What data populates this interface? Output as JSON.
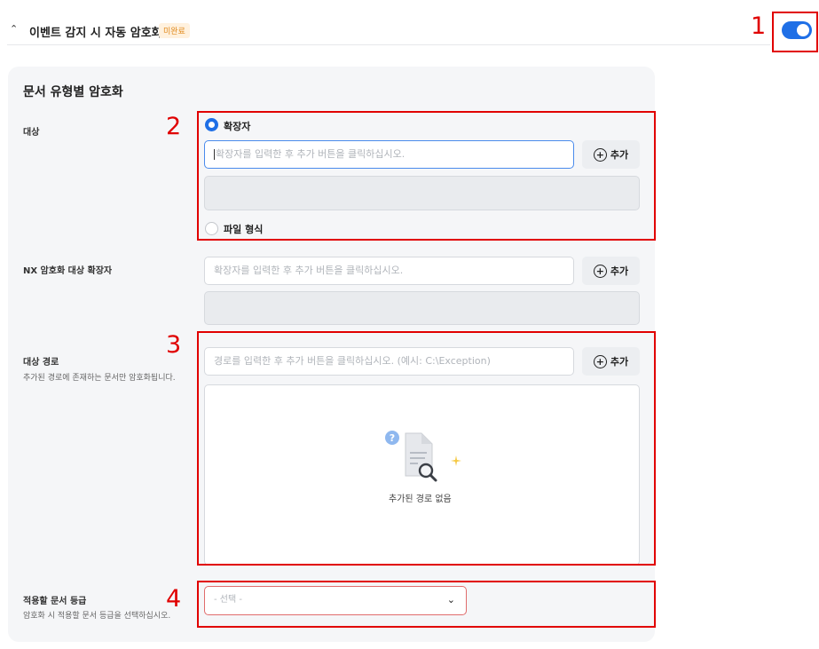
{
  "header": {
    "title": "이벤트 감지 시 자동 암호화",
    "badge": "미완료",
    "toggle_on": true
  },
  "panel": {
    "title": "문서 유형별 암호화"
  },
  "target": {
    "label": "대상",
    "options": [
      {
        "label": "확장자",
        "selected": true
      },
      {
        "label": "파일 형식",
        "selected": false
      }
    ],
    "ext_input_placeholder": "확장자를 입력한 후 추가 버튼을 클릭하십시오.",
    "add_label": "추가"
  },
  "nx": {
    "label": "NX 암호화 대상 확장자",
    "input_placeholder": "확장자를 입력한 후 추가 버튼을 클릭하십시오.",
    "add_label": "추가"
  },
  "path": {
    "label": "대상 경로",
    "sublabel": "추가된 경로에 존재하는 문서만 암호화됩니다.",
    "input_placeholder": "경로를 입력한 후 추가 버튼을 클릭하십시오. (예시: C:\\Exception)",
    "add_label": "추가",
    "empty_text": "추가된 경로 없음"
  },
  "grade": {
    "label": "적용할 문서 등급",
    "sublabel": "암호화 시 적용할 문서 등급을 선택하십시오.",
    "select_value": "- 선택 -"
  },
  "annotations": {
    "n1": "1",
    "n2": "2",
    "n3": "3",
    "n4": "4"
  },
  "colors": {
    "accent": "#1f6fe6",
    "annotation": "#e10000",
    "badge_text": "#e08a1e",
    "badge_bg": "#fff1de"
  }
}
